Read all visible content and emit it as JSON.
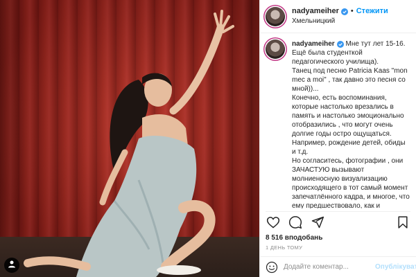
{
  "post": {
    "username": "nadyameiher",
    "follow_label": "Стежити",
    "separator": "•",
    "location": "Хмельницкий"
  },
  "caption": {
    "lines": [
      "Мне тут лет 15-16.",
      "Ещё была студенткой педагогического училища).",
      "Танец под песню Patricia Kaas \"mon mec a moi\" , так давно это песня со мной))...",
      "Конечно, есть воспоминания, которые настолько врезались в память и настолько эмоционально отобразились , что могут очень долгие годы остро ощущаться.",
      "Например, рождение детей, обиды и т.д.",
      "Но согласитесь, фотографии , они ЗАЧАСТУЮ вызывают молниеносную визуализацию происходящего в тот самый момент запечатлённого кадра, и многое, что ему предшествовало, как и следовало за ним. Какие-то из"
    ]
  },
  "stats": {
    "likes": "8 516 вподобань",
    "time": "1 день тому"
  },
  "comment": {
    "placeholder": "Додайте коментар...",
    "post_label": "Опублікувати"
  },
  "icons": {
    "like": "heart-icon",
    "comment": "comment-icon",
    "share": "paper-plane-icon",
    "save": "bookmark-icon",
    "emoji": "smiley-icon",
    "profile": "user-icon",
    "verified": "verified-badge-icon"
  },
  "colors": {
    "accent": "#0095f6",
    "post_disabled": "#b2dffc",
    "muted": "#8e8e8e",
    "text": "#262626",
    "curtain": "#a8271f"
  }
}
